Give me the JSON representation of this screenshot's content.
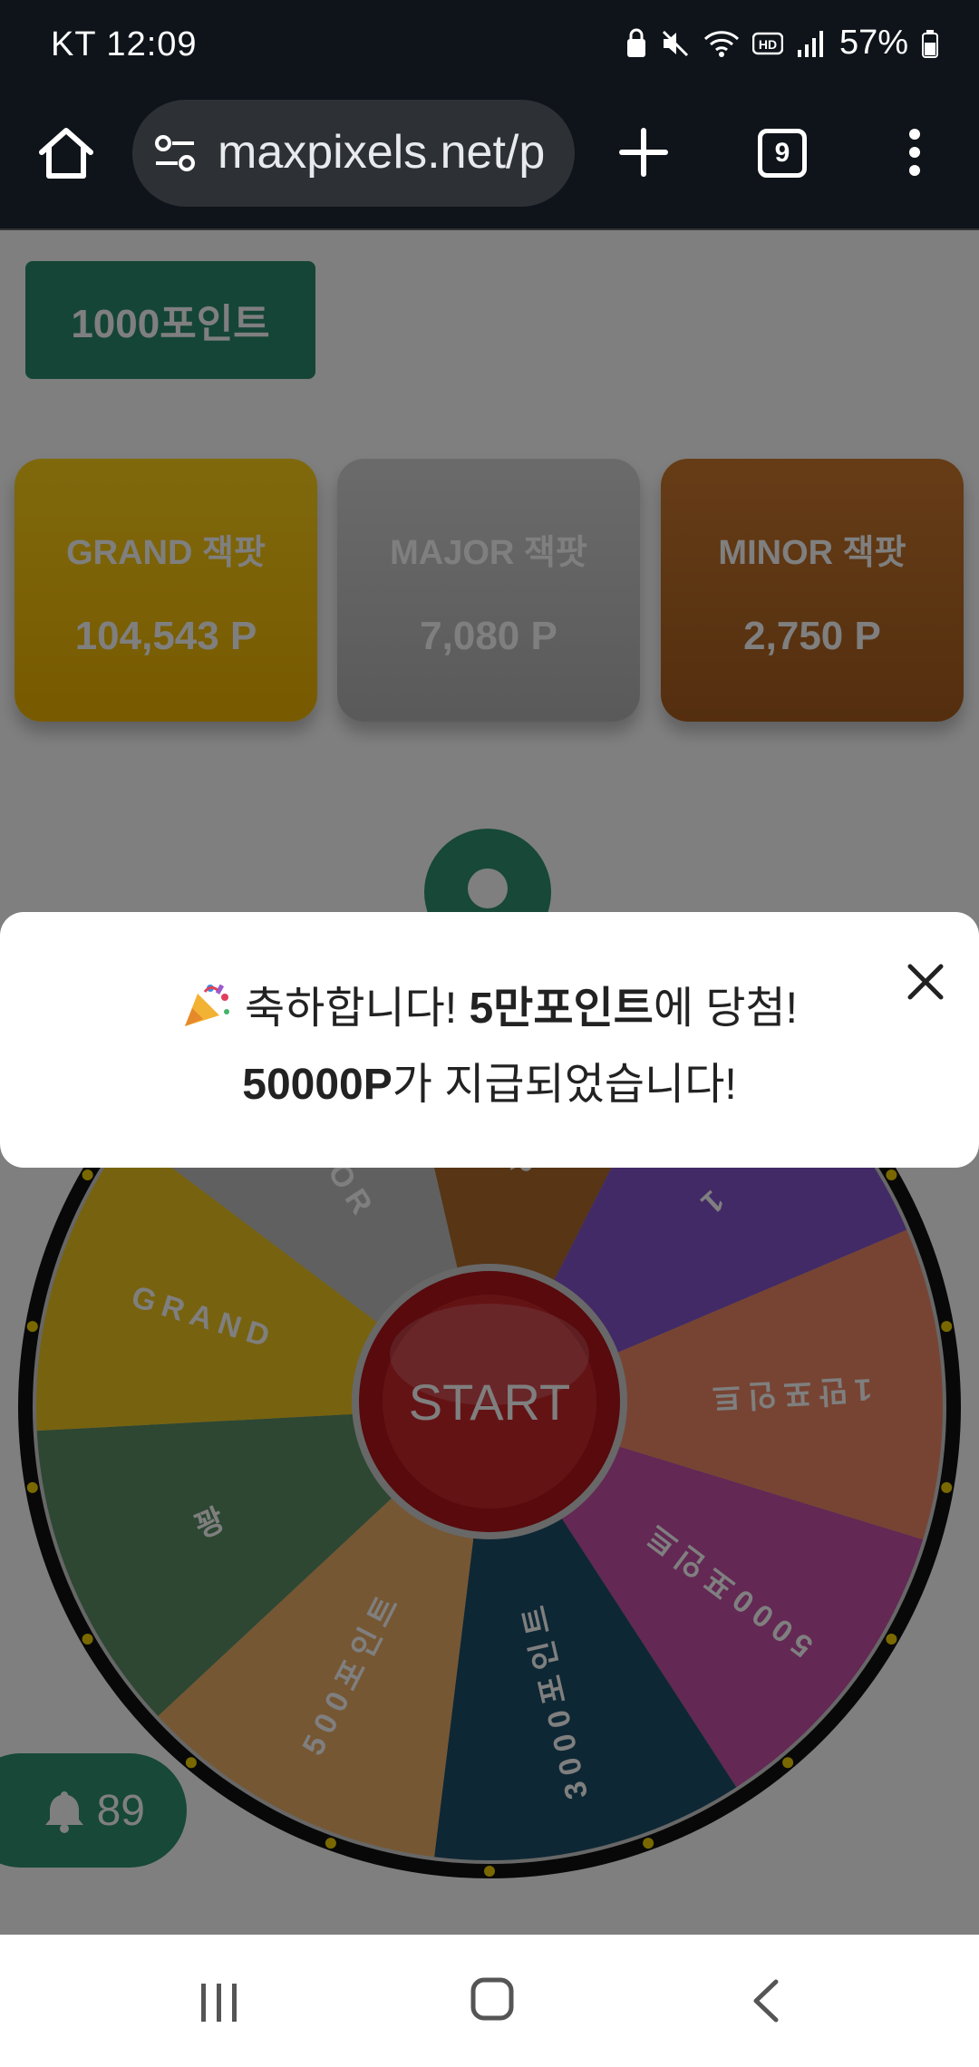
{
  "status_bar": {
    "carrier_time": "KT 12:09",
    "battery_percent": "57%",
    "icons": [
      "lock-icon",
      "mute-icon",
      "wifi-icon",
      "hd-icon",
      "signal-icon",
      "battery-icon"
    ]
  },
  "browser": {
    "url": "maxpixels.net/p",
    "tab_count": "9"
  },
  "page": {
    "points_badge": "1000포인트",
    "jackpots": [
      {
        "title": "GRAND 잭팟",
        "value": "104,543 P",
        "color": "#f5c21b"
      },
      {
        "title": "MAJOR 잭팟",
        "value": "7,080 P",
        "color": "#c4c4c4"
      },
      {
        "title": "MINOR 잭팟",
        "value": "2,750 P",
        "color": "#b86a25"
      }
    ],
    "wheel": {
      "start_label": "START",
      "segments": [
        {
          "label": "꽝",
          "color": "#5a8e64"
        },
        {
          "label": "GRAND",
          "color": "#eec51e"
        },
        {
          "label": "MAJOR",
          "color": "#c0c0c0"
        },
        {
          "label": "MINOR",
          "color": "#ae6a2a"
        },
        {
          "label": "1",
          "color": "#8454cc"
        },
        {
          "label": "1만포인트",
          "color": "#ee8866"
        },
        {
          "label": "5000포인트",
          "color": "#c650a8"
        },
        {
          "label": "3000포인트",
          "color": "#1c4e68"
        },
        {
          "label": "500포인트",
          "color": "#ecae66"
        }
      ]
    },
    "bell": {
      "count": "89"
    }
  },
  "toast": {
    "pre": "축하합니다! ",
    "bold1": "5만포인트",
    "post": "에 당첨!",
    "bold2": "50000P",
    "line2_rest": "가 지급되었습니다!"
  }
}
